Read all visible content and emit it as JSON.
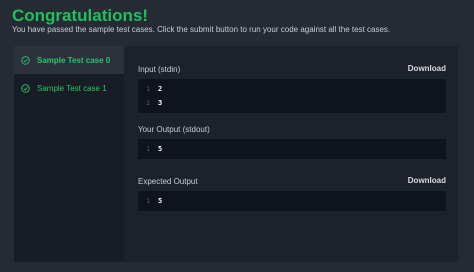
{
  "header": {
    "title": "Congratulations!",
    "subtitle": "You have passed the sample test cases. Click the submit button to run your code against all the test cases."
  },
  "sidebar": {
    "cases": [
      {
        "label": "Sample Test case 0",
        "status": "passed",
        "active": true
      },
      {
        "label": "Sample Test case 1",
        "status": "passed",
        "active": false
      }
    ]
  },
  "input": {
    "label": "Input (stdin)",
    "download_label": "Download",
    "lines": [
      {
        "num": "1",
        "text": "2"
      },
      {
        "num": "2",
        "text": "3"
      }
    ]
  },
  "output": {
    "label": "Your Output (stdout)",
    "lines": [
      {
        "num": "1",
        "text": "5"
      }
    ]
  },
  "expected": {
    "label": "Expected Output",
    "download_label": "Download",
    "lines": [
      {
        "num": "1",
        "text": "5"
      }
    ]
  },
  "colors": {
    "success": "#1ec05f",
    "background": "#262a33",
    "code_background": "#0e131d"
  },
  "icons": {
    "case_status": "check-circle-icon"
  }
}
